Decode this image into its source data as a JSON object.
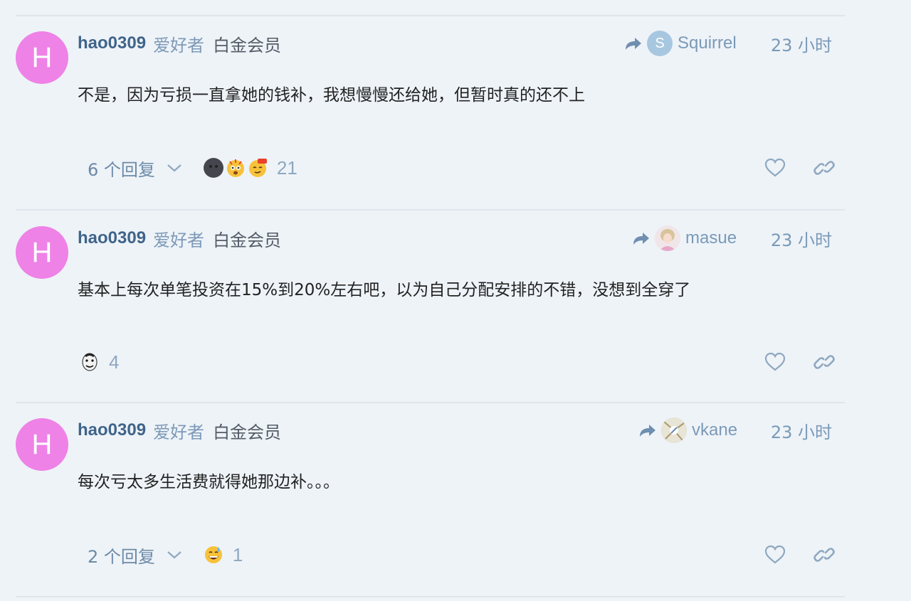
{
  "posts": [
    {
      "avatar_letter": "H",
      "avatar_color": "#ee82e6",
      "username": "hao0309",
      "title_badge": "爱好者",
      "group_badge": "白金会员",
      "reply_to": {
        "name": "Squirrel",
        "avatar_letter": "S",
        "avatar_color": "#a7c7e0"
      },
      "time": "23 小时",
      "content": "不是，因为亏损一直拿她的钱补，我想慢慢还给她，但暂时真的还不上",
      "replies_label": "6 个回复",
      "reactions": {
        "icons": [
          "new-moon-face-icon",
          "exploding-head-icon",
          "smirking-666-icon"
        ],
        "count": "21"
      }
    },
    {
      "avatar_letter": "H",
      "avatar_color": "#ee82e6",
      "username": "hao0309",
      "title_badge": "爱好者",
      "group_badge": "白金会员",
      "reply_to": {
        "name": "masue",
        "avatar_letter": "",
        "avatar_color": "#e9d9e2"
      },
      "time": "23 小时",
      "content": "基本上每次单笔投资在15%到20%左右吧，以为自己分配安排的不错，没想到全穿了",
      "replies_label": "",
      "reactions": {
        "icons": [
          "meme-face-icon"
        ],
        "count": "4"
      }
    },
    {
      "avatar_letter": "H",
      "avatar_color": "#ee82e6",
      "username": "hao0309",
      "title_badge": "爱好者",
      "group_badge": "白金会员",
      "reply_to": {
        "name": "vkane",
        "avatar_letter": "",
        "avatar_color": "#d8d4c4"
      },
      "time": "23 小时",
      "content": "每次亏太多生活费就得她那边补。。。",
      "replies_label": "2 个回复",
      "reactions": {
        "icons": [
          "grinning-sweat-icon"
        ],
        "count": "1"
      }
    }
  ],
  "colors": {
    "background": "#eef3f8",
    "username": "#40648a",
    "meta_muted": "#7a9ab8",
    "divider": "#dfe5ec"
  }
}
